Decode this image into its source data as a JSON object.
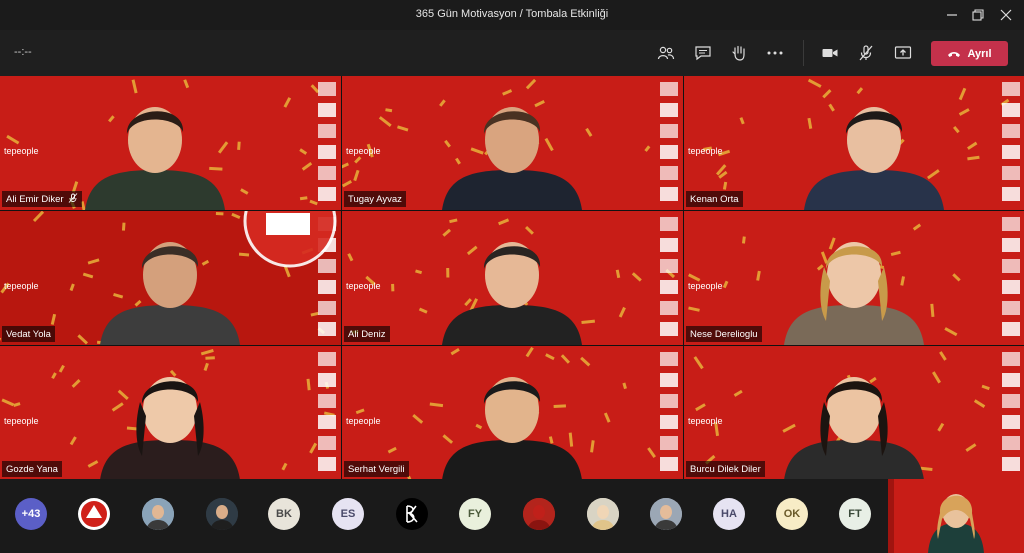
{
  "window": {
    "title": "365 Gün Motivasyon / Tombala Etkinliği"
  },
  "toolbar": {
    "timer": "--:--",
    "leave_label": "Ayrıl"
  },
  "participants": [
    {
      "name": "Ali Emir Diker",
      "muted": true
    },
    {
      "name": "Tugay Ayvaz",
      "muted": false
    },
    {
      "name": "Kenan Orta",
      "muted": false
    },
    {
      "name": "Vedat Yola",
      "muted": false
    },
    {
      "name": "Ali Deniz",
      "muted": false
    },
    {
      "name": "Nese Derelioglu",
      "muted": false
    },
    {
      "name": "Gozde Yana",
      "muted": false
    },
    {
      "name": "Serhat Vergili",
      "muted": false
    },
    {
      "name": "Burcu Dilek Diler",
      "muted": false
    }
  ],
  "strip": {
    "overflow_count": "+43",
    "avatars": [
      {
        "type": "logo"
      },
      {
        "type": "photo"
      },
      {
        "type": "photo"
      },
      {
        "type": "initials",
        "text": "BK",
        "bg": "#e8e4da",
        "fg": "#4a4a4a"
      },
      {
        "type": "initials",
        "text": "ES",
        "bg": "#e6e3f2",
        "fg": "#4a4a6a"
      },
      {
        "type": "bk-logo"
      },
      {
        "type": "initials",
        "text": "FY",
        "bg": "#e9f0dc",
        "fg": "#4a5a3a"
      },
      {
        "type": "photo"
      },
      {
        "type": "photo"
      },
      {
        "type": "photo"
      },
      {
        "type": "initials",
        "text": "HA",
        "bg": "#e6e3f2",
        "fg": "#4a4a6a"
      },
      {
        "type": "initials",
        "text": "OK",
        "bg": "#f7ecc6",
        "fg": "#6a5a2a"
      },
      {
        "type": "initials",
        "text": "FT",
        "bg": "#e8efe6",
        "fg": "#3a4a3a"
      }
    ]
  },
  "branding": {
    "left_logo": "tepeople",
    "accent": "#c81d17",
    "leave_color": "#c4314b"
  }
}
